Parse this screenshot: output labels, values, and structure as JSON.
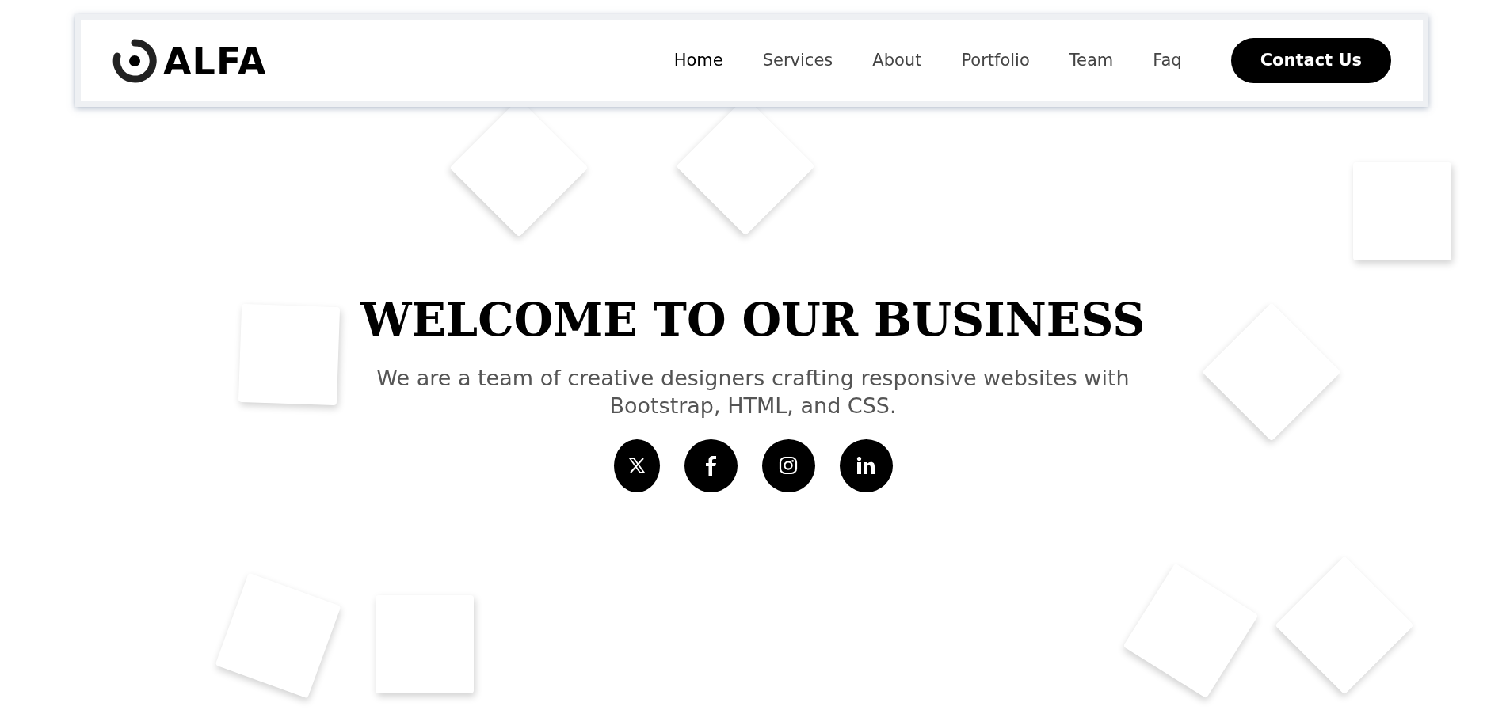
{
  "navbar": {
    "logo": "ALFA",
    "links": [
      {
        "label": "Home",
        "selected": true
      },
      {
        "label": "Services",
        "selected": false
      },
      {
        "label": "About",
        "selected": false
      },
      {
        "label": "Portfolio",
        "selected": false
      },
      {
        "label": "Team",
        "selected": false
      },
      {
        "label": "Faq",
        "selected": false
      }
    ],
    "button": "Contact Us"
  },
  "hero": {
    "title": "WELCOME TO OUR BUSINESS",
    "subtitle": "We are a team of creative designers crafting responsive websites with Bootstrap, HTML, and CSS.",
    "social": [
      {
        "kind": "x"
      },
      {
        "kind": "facebook"
      },
      {
        "kind": "instagram"
      },
      {
        "kind": "linkedin"
      }
    ]
  }
}
